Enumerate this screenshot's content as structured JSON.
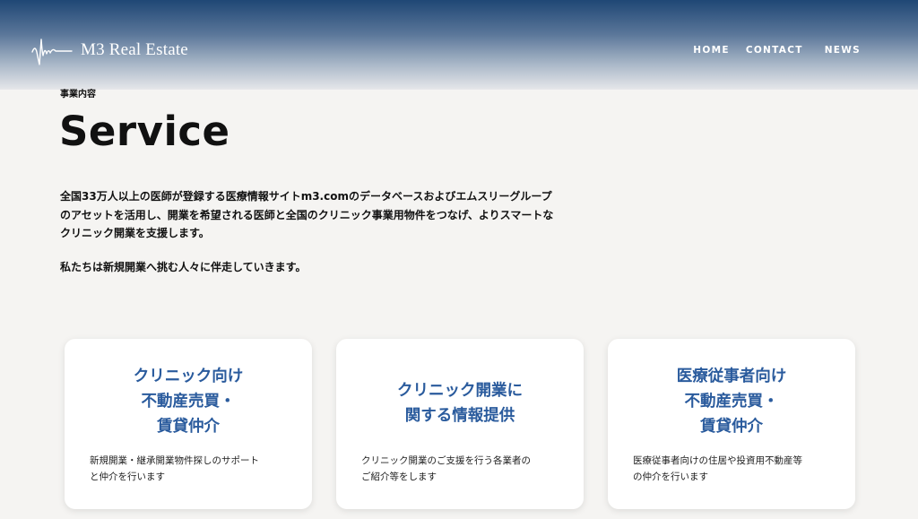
{
  "header": {
    "logo_text": "M3 Real Estate",
    "logo_icon": "waveform-signature-icon",
    "nav": {
      "home": "HOME",
      "contact": "CONTACT",
      "news": "NEWS"
    }
  },
  "section": {
    "eyebrow": "事業内容",
    "title": "Service",
    "intro": "全国33万人以上の医師が登録する医療情報サイトm3.comのデータベースおよびエムスリーグループ\nのアセットを活用し、開業を希望される医師と全国のクリニック事業用物件をつなげ、よりスマートな\nクリニック開業を支援します。",
    "outro": "私たちは新規開業へ挑む人々に伴走していきます。"
  },
  "cards": [
    {
      "title": "クリニック向け\n不動産売買・\n賃貸仲介",
      "desc": "新規開業・継承開業物件探しのサポート\nと仲介を行います"
    },
    {
      "title": "クリニック開業に\n関する情報提供",
      "desc": "クリニック開業のご支援を行う各業者の\nご紹介等をします"
    },
    {
      "title": "医療従事者向け\n不動産売買・\n賃貸仲介",
      "desc": "医療従事者向けの住居や投資用不動産等\nの仲介を行います"
    }
  ],
  "colors": {
    "header_top": "#1f4775",
    "background": "#f5f4f2",
    "card_title": "#2a5b9d"
  }
}
